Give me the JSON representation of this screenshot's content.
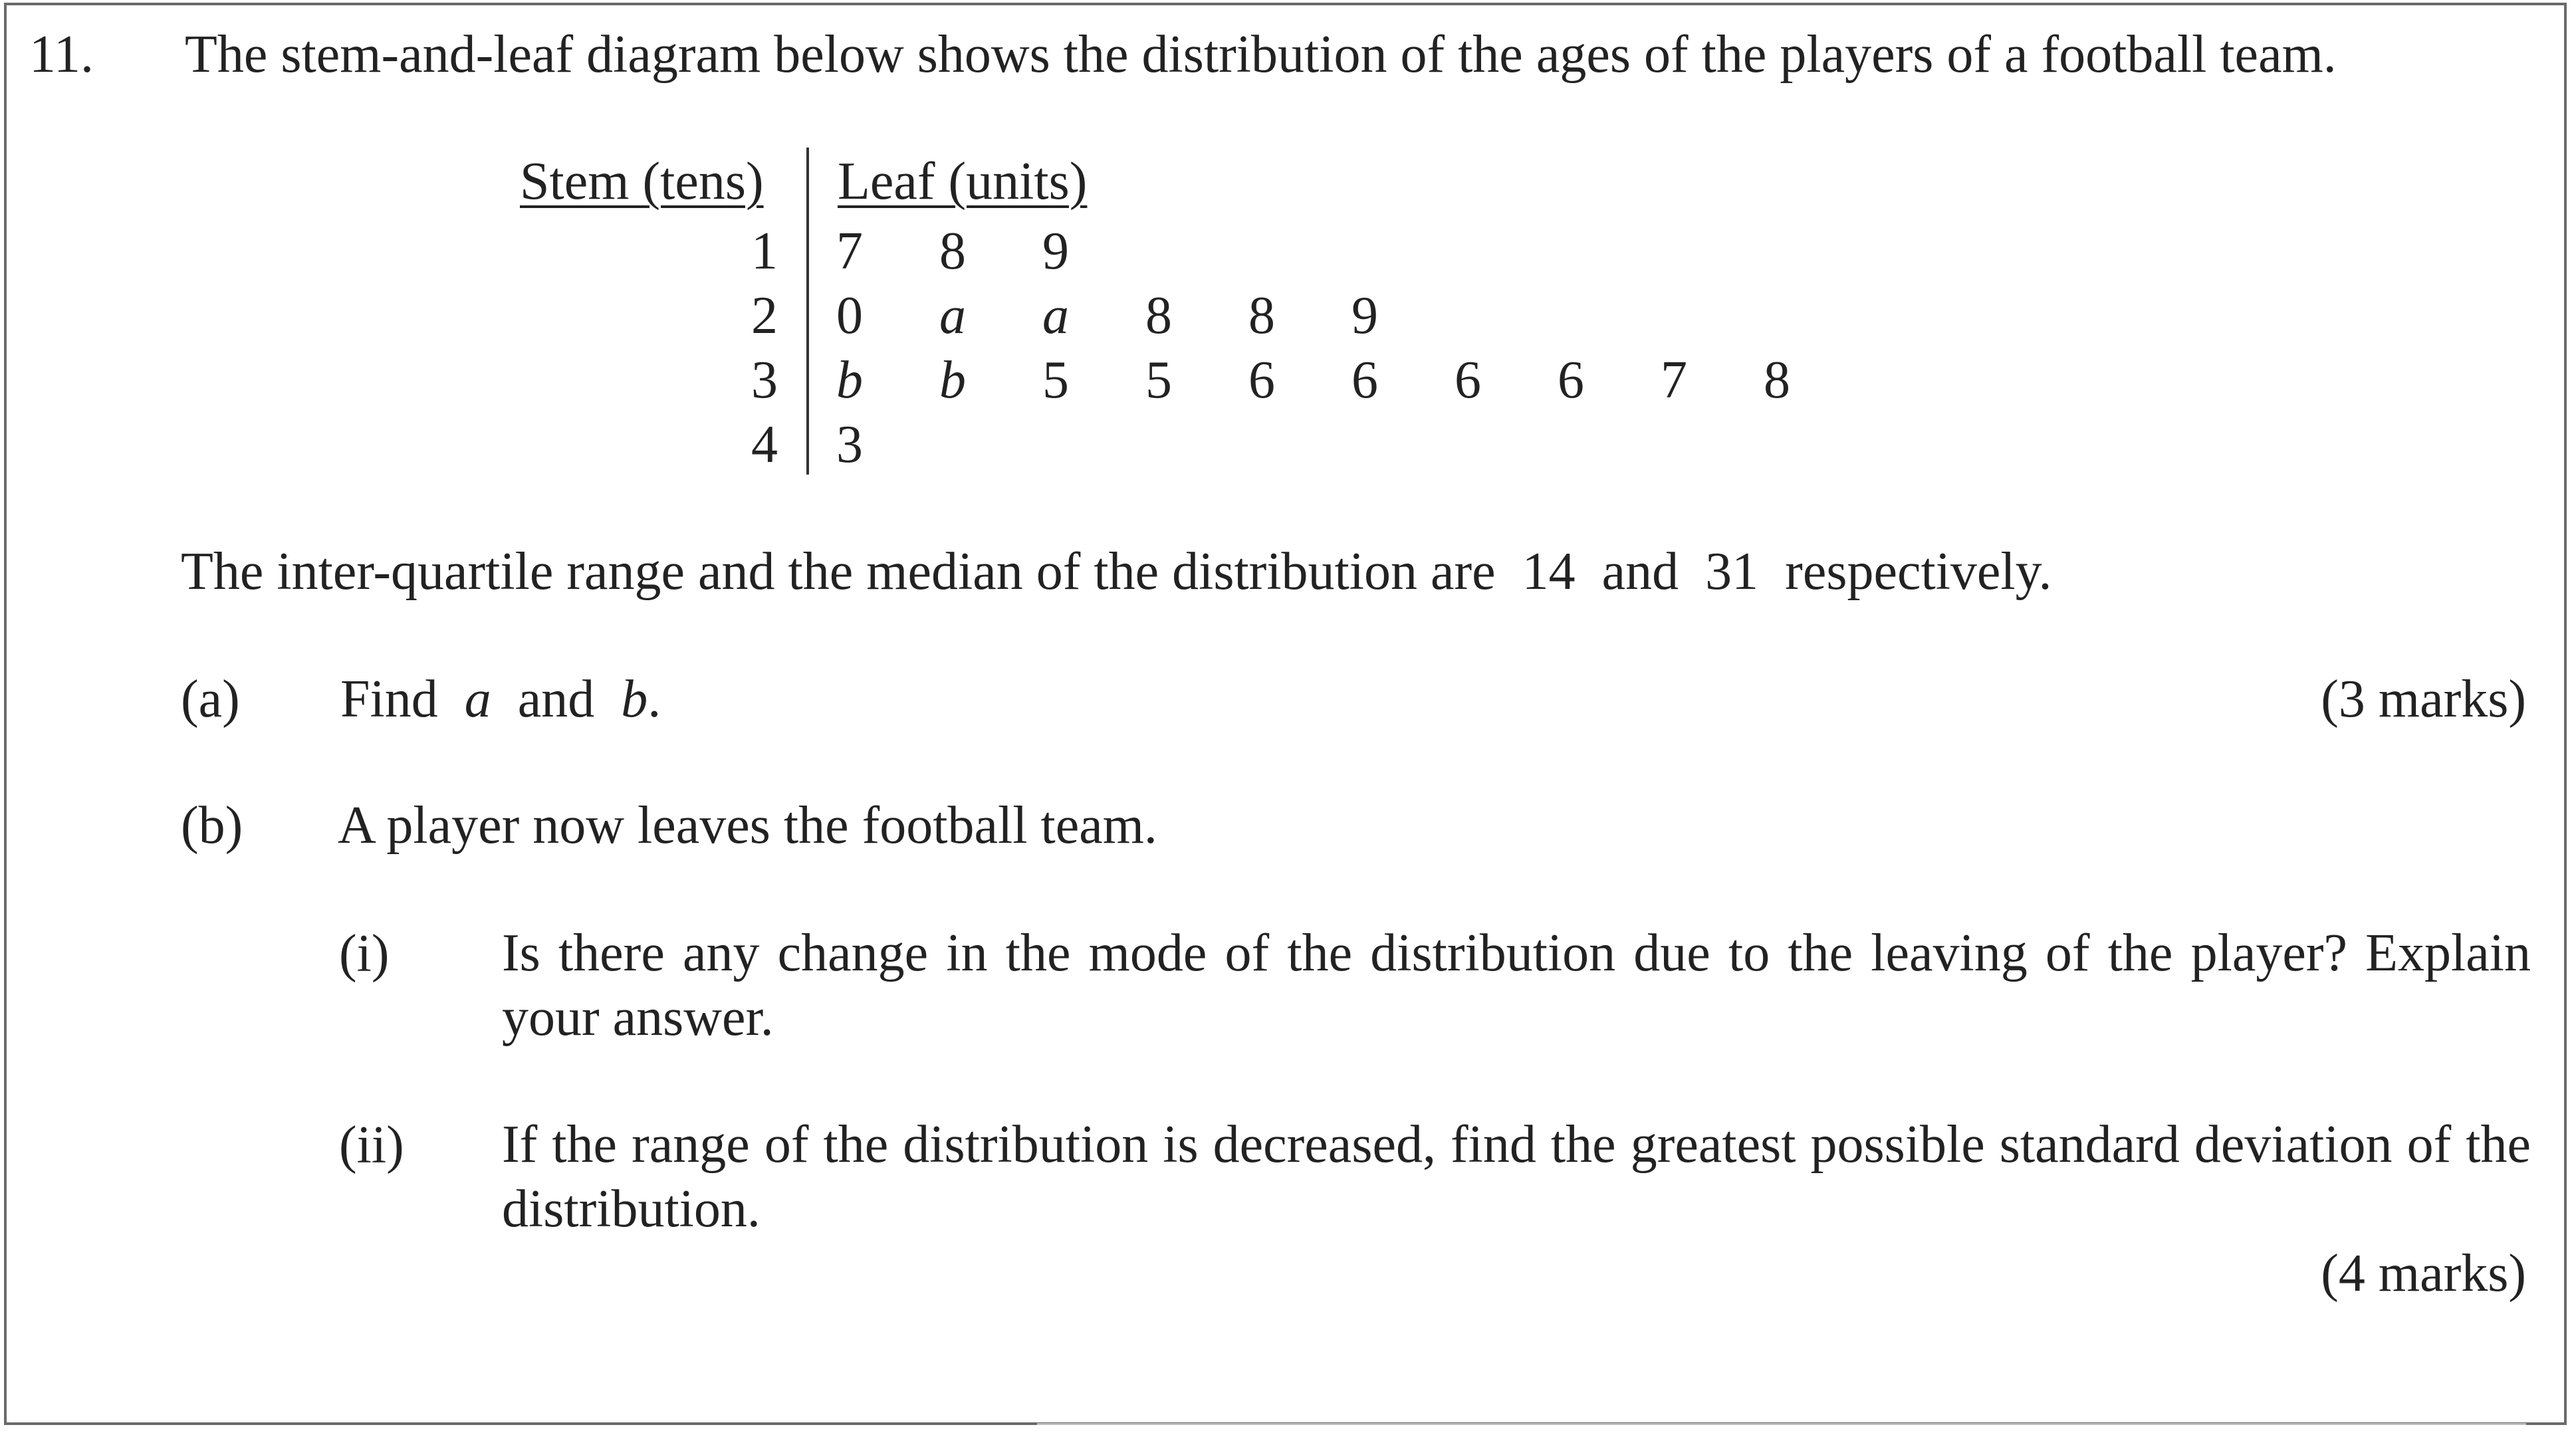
{
  "question": {
    "number": "11.",
    "intro": "The stem-and-leaf diagram below shows the distribution of the ages of the players of a football team.",
    "stem_header": "Stem (tens)",
    "leaf_header": "Leaf (units)",
    "rows": [
      {
        "stem": "1",
        "leaves": [
          "7",
          "8",
          "9"
        ]
      },
      {
        "stem": "2",
        "leaves": [
          "0",
          "a",
          "a",
          "8",
          "8",
          "9"
        ]
      },
      {
        "stem": "3",
        "leaves": [
          "b",
          "b",
          "5",
          "5",
          "6",
          "6",
          "6",
          "6",
          "7",
          "8"
        ]
      },
      {
        "stem": "4",
        "leaves": [
          "3"
        ]
      }
    ],
    "info": {
      "before": "The inter-quartile range and the median of the distribution are",
      "iqr": "14",
      "and": "and",
      "median": "31",
      "after": "respectively."
    },
    "part_a": {
      "label": "(a)",
      "find": "Find",
      "var1": "a",
      "and": "and",
      "var2": "b",
      "period": ".",
      "marks": "(3 marks)"
    },
    "part_b": {
      "label": "(b)",
      "text": "A player now leaves the football team.",
      "sub_i": {
        "label": "(i)",
        "text": "Is there any change in the mode of the distribution due to the leaving of the player? Explain your answer."
      },
      "sub_ii": {
        "label": "(ii)",
        "text": "If the range of the distribution is decreased, find the greatest possible standard deviation of the distribution."
      },
      "marks": "(4 marks)"
    }
  }
}
